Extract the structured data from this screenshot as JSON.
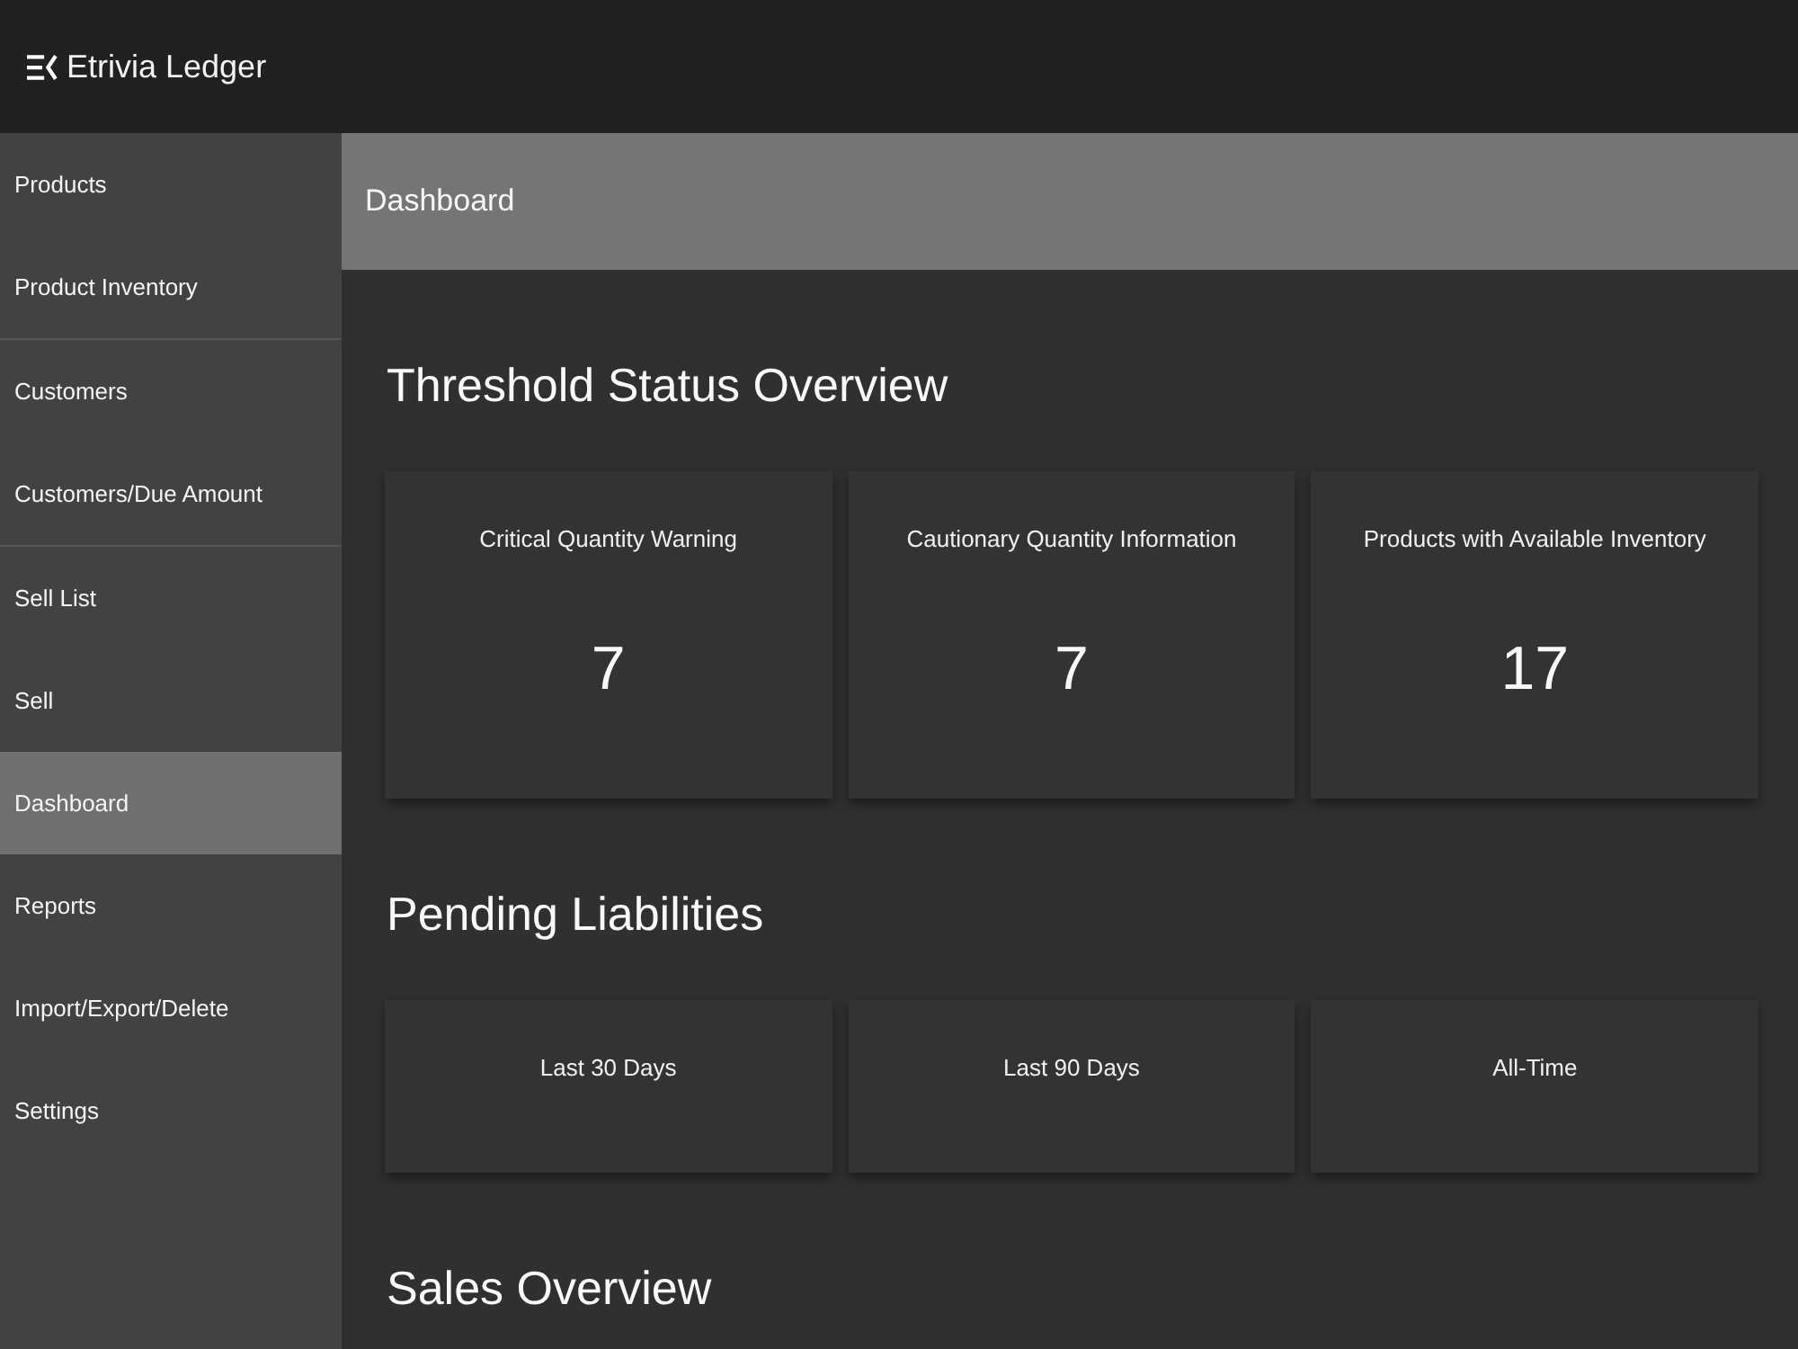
{
  "app": {
    "title": "Etrivia Ledger"
  },
  "sidebar": {
    "groups": [
      {
        "items": [
          {
            "label": "Products",
            "selected": false
          },
          {
            "label": "Product Inventory",
            "selected": false
          }
        ]
      },
      {
        "items": [
          {
            "label": "Customers",
            "selected": false
          },
          {
            "label": "Customers/Due Amount",
            "selected": false
          }
        ]
      },
      {
        "items": [
          {
            "label": "Sell List",
            "selected": false
          },
          {
            "label": "Sell",
            "selected": false
          },
          {
            "label": "Dashboard",
            "selected": true
          },
          {
            "label": "Reports",
            "selected": false
          },
          {
            "label": "Import/Export/Delete",
            "selected": false
          },
          {
            "label": "Settings",
            "selected": false
          }
        ]
      }
    ]
  },
  "page_header": {
    "title": "Dashboard"
  },
  "sections": [
    {
      "title": "Threshold Status Overview",
      "cards": [
        {
          "label": "Critical Quantity Warning",
          "value": "7"
        },
        {
          "label": "Cautionary Quantity Information",
          "value": "7"
        },
        {
          "label": "Products with Available Inventory",
          "value": "17"
        }
      ]
    },
    {
      "title": "Pending Liabilities",
      "cards": [
        {
          "label": "Last 30 Days"
        },
        {
          "label": "Last 90 Days"
        },
        {
          "label": "All-Time"
        }
      ]
    },
    {
      "title": "Sales Overview"
    }
  ]
}
